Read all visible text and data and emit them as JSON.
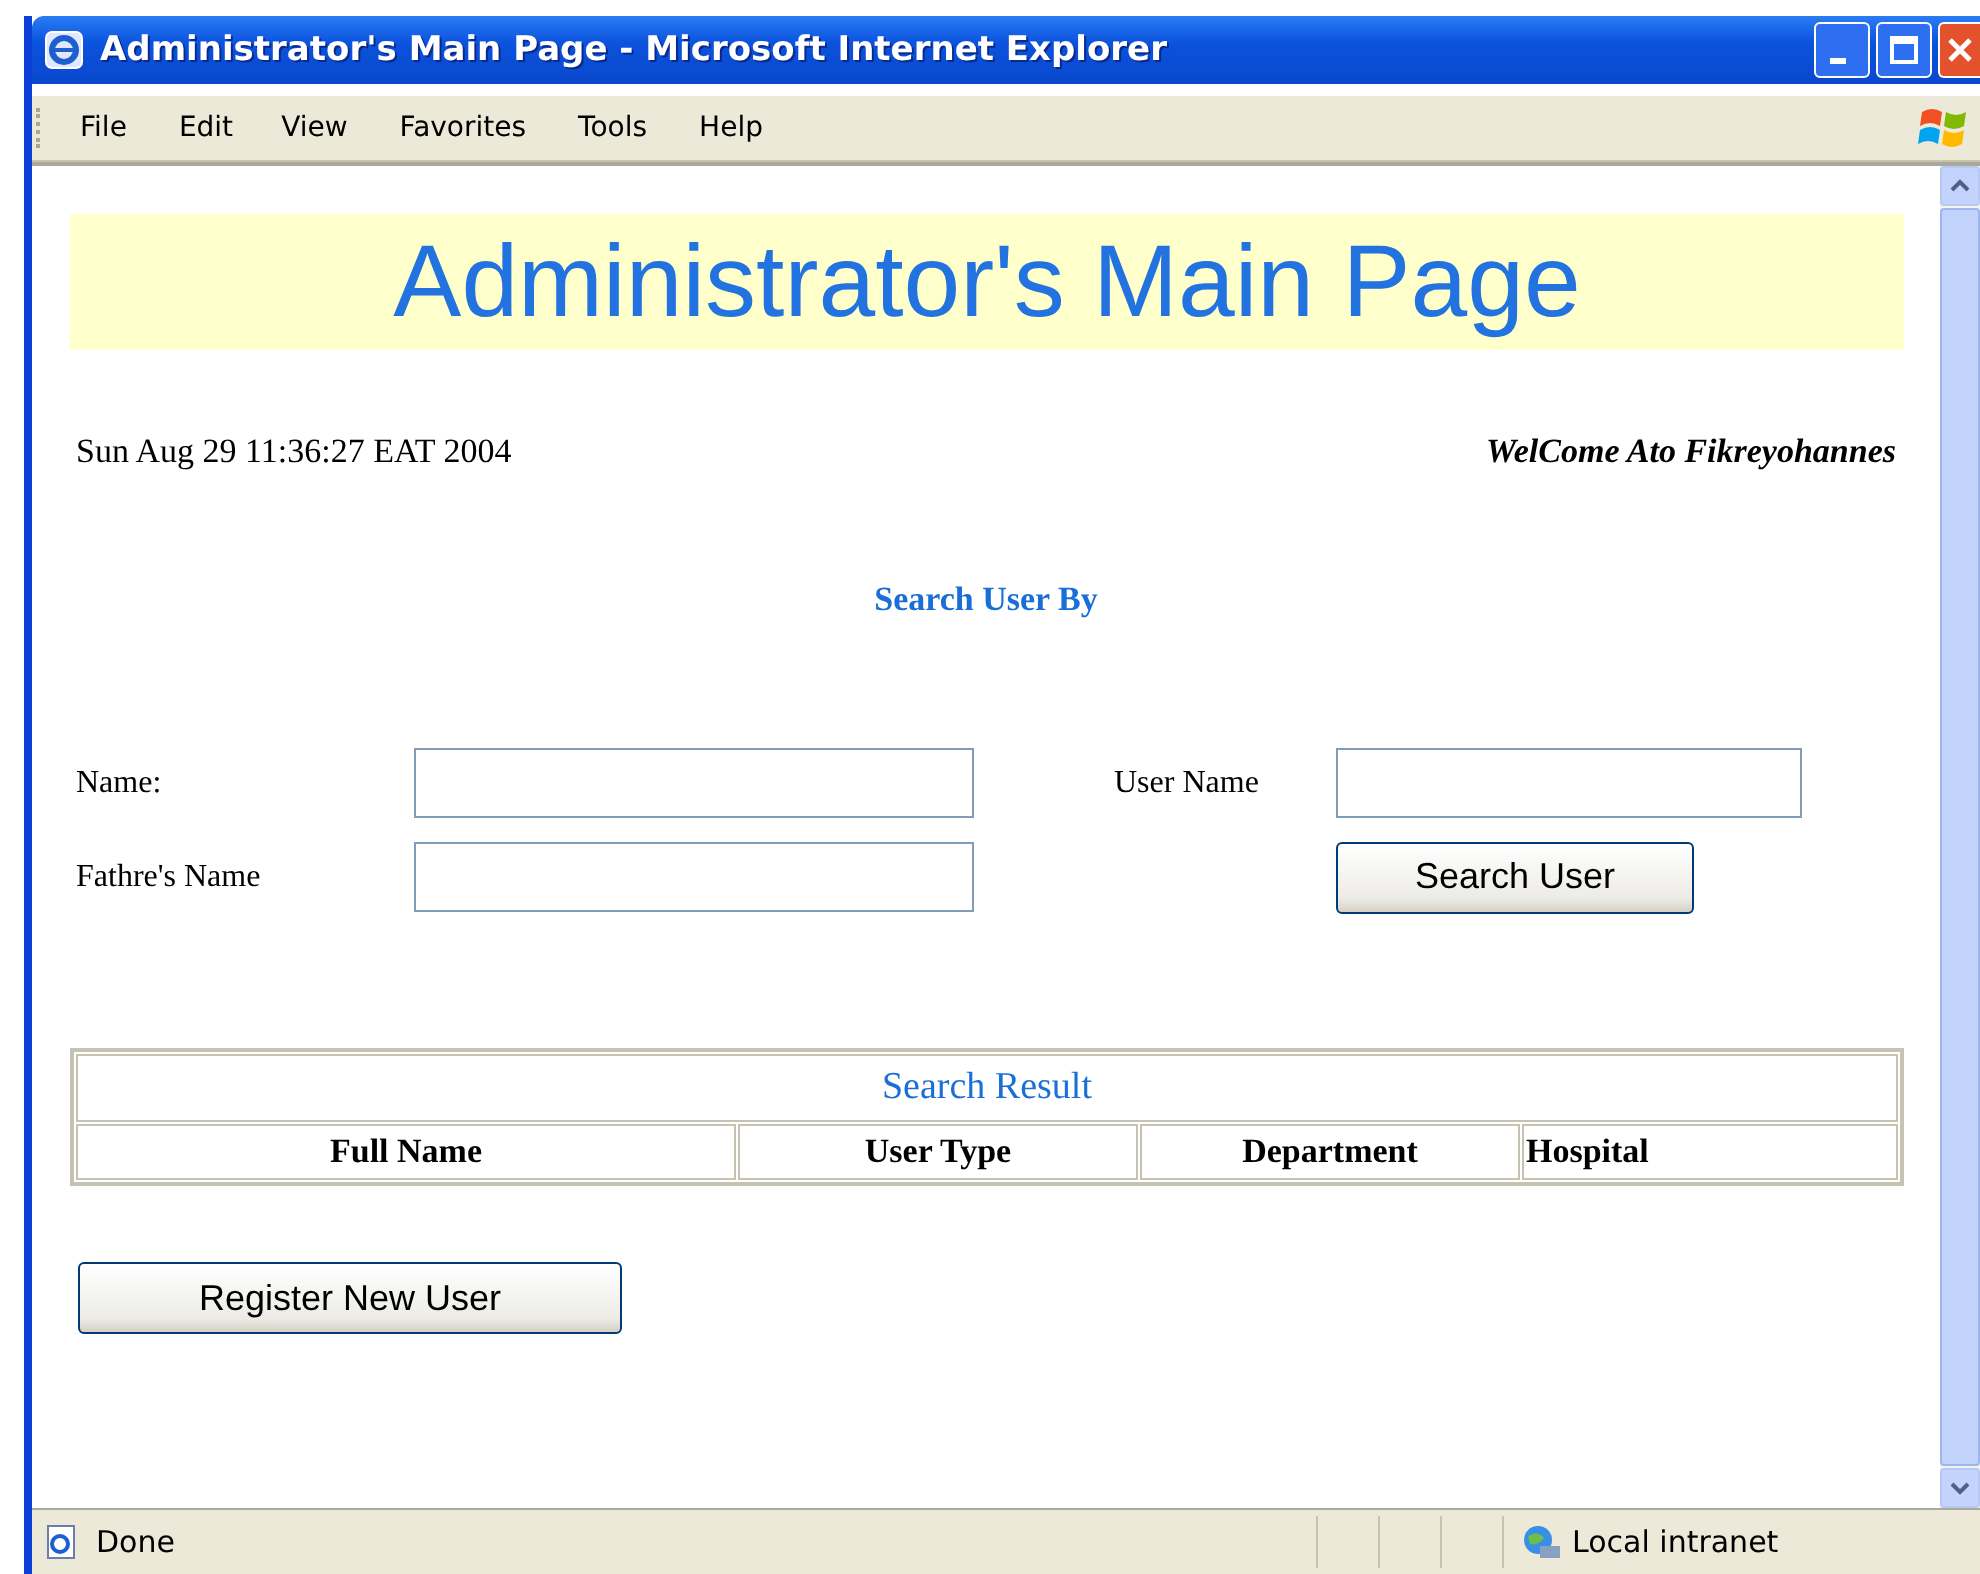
{
  "window": {
    "title": "Administrator's Main Page - Microsoft Internet Explorer"
  },
  "menu": [
    "File",
    "Edit",
    "View",
    "Favorites",
    "Tools",
    "Help"
  ],
  "page": {
    "heading": "Administrator's Main Page",
    "date": "Sun Aug 29 11:36:27 EAT 2004",
    "welcome": "WelCome Ato Fikreyohannes",
    "search_title": "Search User By",
    "fields": [
      {
        "label": "Name:"
      },
      {
        "label": "User Name"
      },
      {
        "label": "Fathre's Name"
      }
    ],
    "search_button": "Search User",
    "table": {
      "caption": "Search Result",
      "columns": [
        "Full Name",
        "User Type",
        "Department",
        "Hospital"
      ]
    },
    "register_button": "Register New User"
  },
  "status_bar": {
    "status": "Done",
    "zone": "Local intranet"
  }
}
